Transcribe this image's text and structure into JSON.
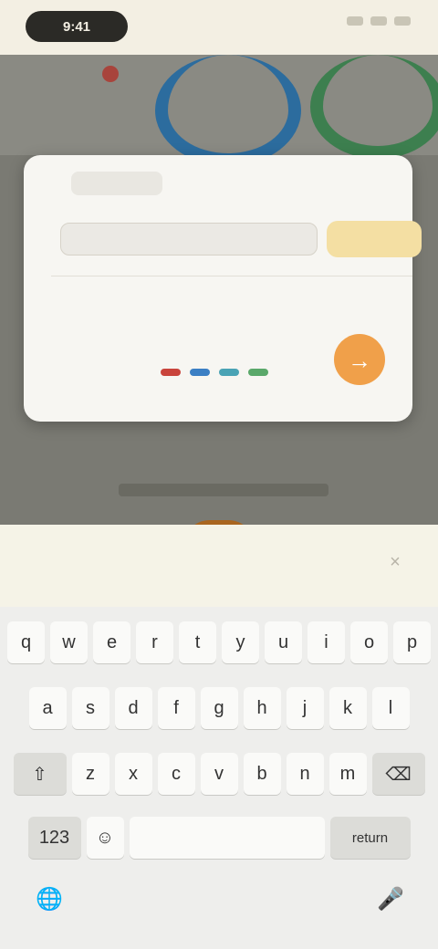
{
  "status": {
    "time": "9:41"
  },
  "dialog": {
    "tab_label": "",
    "title": "",
    "input_placeholder": "",
    "confirm_label": "",
    "section_label": "",
    "stat_1": "",
    "stat_2": "",
    "stat_3": ""
  },
  "orange_button": {
    "icon": "arrow-icon"
  },
  "dock": {
    "play_label": ""
  },
  "text_input": {
    "value": ""
  },
  "keyboard": {
    "row1": [
      "q",
      "w",
      "e",
      "r",
      "t",
      "y",
      "u",
      "i",
      "o",
      "p"
    ],
    "row2": [
      "a",
      "s",
      "d",
      "f",
      "g",
      "h",
      "j",
      "k",
      "l"
    ],
    "row3": [
      "z",
      "x",
      "c",
      "v",
      "b",
      "n",
      "m"
    ],
    "numbers_key": "123",
    "emoji_key": "☺",
    "space_key": "",
    "return_key": "return",
    "shift_key": "⇧",
    "delete_key": "⌫"
  },
  "colors": {
    "board": "#7a7a73",
    "ring_blue": "#2c6c9e",
    "ring_green": "#3d7f4f",
    "confirm": "#f4dfa3",
    "orange_action": "#f0a04a",
    "play": "#a9651f",
    "dot_red": "#c9443c",
    "dot_blue": "#3b7fc4",
    "dot_teal": "#4aa3b5",
    "dot_green": "#5aa86a"
  }
}
